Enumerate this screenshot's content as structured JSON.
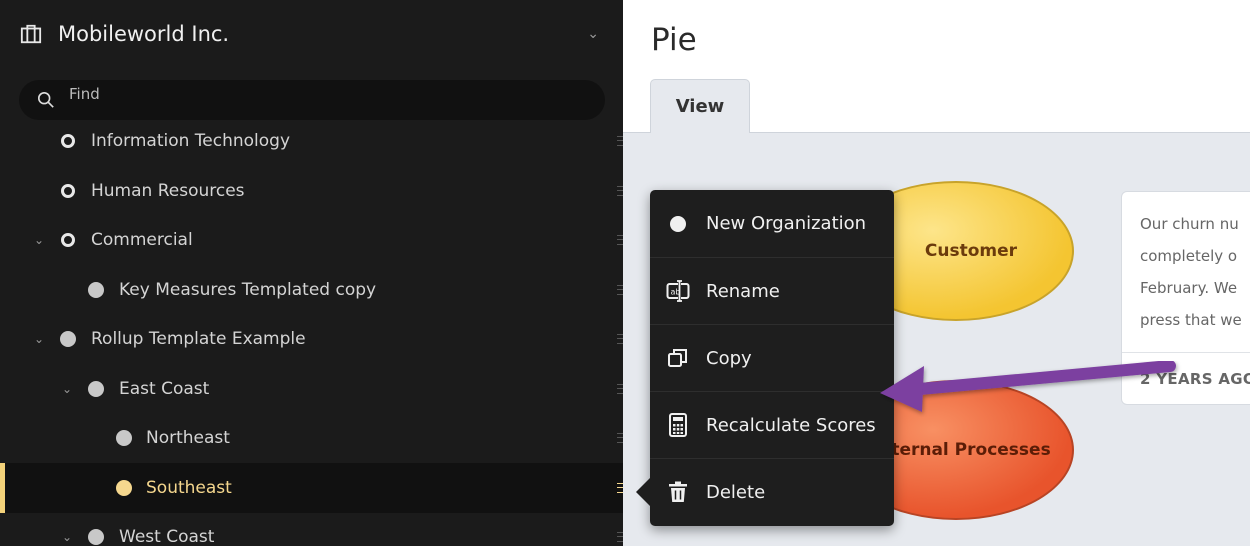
{
  "org": {
    "name": "Mobileworld Inc."
  },
  "search": {
    "placeholder": "Find"
  },
  "tree": [
    {
      "label": "Information Technology"
    },
    {
      "label": "Human Resources"
    },
    {
      "label": "Commercial"
    },
    {
      "label": "Key Measures Templated copy"
    },
    {
      "label": "Rollup Template Example"
    },
    {
      "label": "East Coast"
    },
    {
      "label": "Northeast"
    },
    {
      "label": "Southeast"
    },
    {
      "label": "West Coast"
    }
  ],
  "page": {
    "title": "Pie",
    "tab_label": "View"
  },
  "bubbles": {
    "customer": "Customer",
    "internal": "ternal Processes"
  },
  "card": {
    "lines": [
      "Our churn nu",
      "completely o",
      "February. We",
      "press that we"
    ],
    "time": "2 YEARS AGO"
  },
  "menu": {
    "items": [
      {
        "label": "New Organization",
        "icon": "dot-icon"
      },
      {
        "label": "Rename",
        "icon": "rename-icon"
      },
      {
        "label": "Copy",
        "icon": "copy-icon"
      },
      {
        "label": "Recalculate Scores",
        "icon": "calculator-icon"
      },
      {
        "label": "Delete",
        "icon": "trash-icon"
      }
    ]
  },
  "colors": {
    "sidebar_bg": "#1b1b1b",
    "selected_accent": "#f5d78e",
    "annotation_arrow": "#7b3fa0",
    "customer_bubble": "#f4c531",
    "internal_bubble": "#e8542c"
  }
}
